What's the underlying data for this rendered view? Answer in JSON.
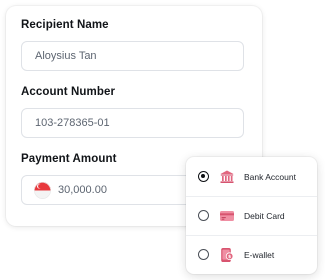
{
  "form": {
    "recipient": {
      "label": "Recipient Name",
      "value": "Aloysius Tan"
    },
    "account": {
      "label": "Account Number",
      "value": "103-278365-01"
    },
    "amount": {
      "label": "Payment Amount",
      "value": "30,000.00",
      "flag_icon": "singapore-flag-icon"
    }
  },
  "payment_methods": {
    "selected": "Bank Account",
    "options": [
      {
        "label": "Bank Account",
        "icon": "bank-icon",
        "checked": true
      },
      {
        "label": "Debit Card",
        "icon": "debit-card-icon",
        "checked": false
      },
      {
        "label": "E-wallet",
        "icon": "e-wallet-icon",
        "checked": false
      }
    ]
  },
  "colors": {
    "accent_pink": "#e35d7a",
    "bank_icon": "#e2667f",
    "flag_red": "#e8383d"
  }
}
